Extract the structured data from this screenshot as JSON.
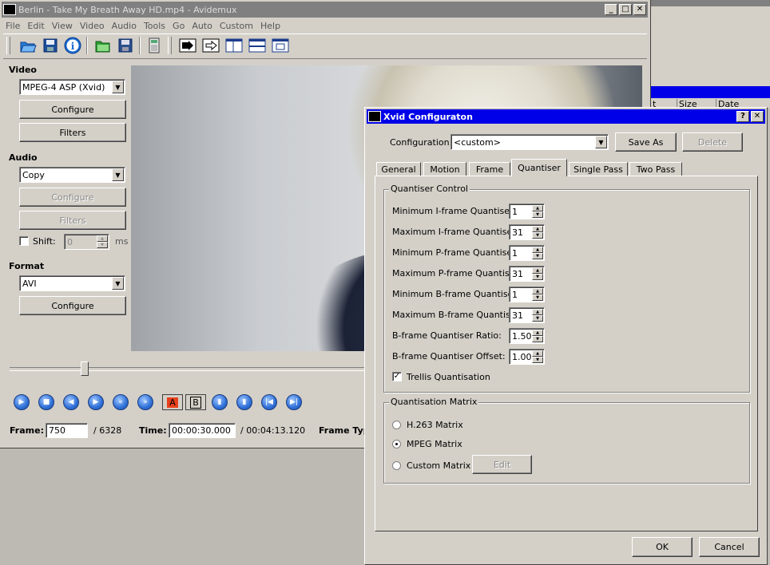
{
  "main_window": {
    "title": "Berlin - Take My Breath Away HD.mp4 - Avidemux",
    "menu": [
      "File",
      "Edit",
      "View",
      "Video",
      "Audio",
      "Tools",
      "Go",
      "Auto",
      "Custom",
      "Help"
    ],
    "toolbar_icons": [
      "open-icon",
      "save-icon",
      "info-icon",
      "open-folder-icon",
      "save-disk-icon",
      "calculator-icon",
      "play-filtered-icon",
      "output-icon",
      "layout-side-icon",
      "layout-horizontal-icon",
      "layout-window-icon"
    ],
    "video": {
      "section_label": "Video",
      "codec_value": "MPEG-4 ASP (Xvid)",
      "configure_label": "Configure",
      "filters_label": "Filters"
    },
    "audio": {
      "section_label": "Audio",
      "codec_value": "Copy",
      "configure_label": "Configure",
      "filters_label": "Filters",
      "shift_label": "Shift:",
      "shift_value": "0",
      "shift_unit": "ms"
    },
    "format": {
      "section_label": "Format",
      "container_value": "AVI",
      "configure_label": "Configure"
    },
    "timeline": {
      "position_fraction": 0.118
    },
    "controls": {
      "frame_label": "Frame:",
      "frame_value": "750",
      "frame_total": "/ 6328",
      "time_label": "Time:",
      "time_value": "00:00:30.000",
      "time_total": "/ 00:04:13.120",
      "frame_type_label": "Frame Typ",
      "marker_a": "A",
      "marker_b": "B"
    }
  },
  "background_window": {
    "column_headers": [
      "t",
      "Size",
      "Date"
    ]
  },
  "dialog": {
    "title": "Xvid Configuraton",
    "configuration_label": "Configuration:",
    "configuration_value": "<custom>",
    "save_as_label": "Save As",
    "delete_label": "Delete",
    "tabs": [
      "General",
      "Motion",
      "Frame",
      "Quantiser",
      "Single Pass",
      "Two Pass"
    ],
    "active_tab": "Quantiser",
    "quantiser_control": {
      "group_label": "Quantiser Control",
      "rows": [
        {
          "label": "Minimum I-frame Quantiser:",
          "value": "1"
        },
        {
          "label": "Maximum I-frame Quantiser:",
          "value": "31"
        },
        {
          "label": "Minimum P-frame Quantiser:",
          "value": "1"
        },
        {
          "label": "Maximum P-frame Quantiser:",
          "value": "31"
        },
        {
          "label": "Minimum B-frame Quantiser:",
          "value": "1"
        },
        {
          "label": "Maximum B-frame Quantiser:",
          "value": "31"
        },
        {
          "label": "B-frame Quantiser Ratio:",
          "value": "1.50"
        },
        {
          "label": "B-frame Quantiser Offset:",
          "value": "1.00"
        }
      ],
      "trellis_label": "Trellis Quantisation",
      "trellis_checked": true
    },
    "quantisation_matrix": {
      "group_label": "Quantisation Matrix",
      "options": [
        "H.263 Matrix",
        "MPEG Matrix",
        "Custom Matrix"
      ],
      "selected": "MPEG Matrix",
      "edit_label": "Edit"
    },
    "ok_label": "OK",
    "cancel_label": "Cancel"
  }
}
